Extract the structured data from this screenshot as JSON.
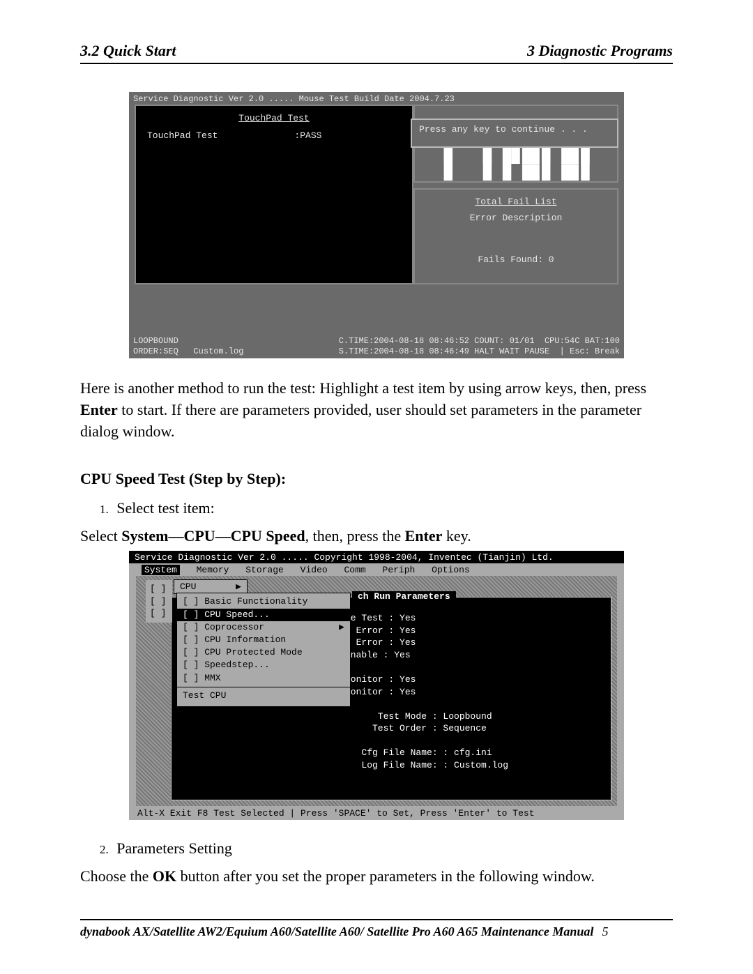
{
  "header": {
    "left": "3.2 Quick Start",
    "right": "3  Diagnostic Programs"
  },
  "screenshot1": {
    "titlebar": "Service Diagnostic Ver 2.0 ..... Mouse Test Build Date 2004.7.23",
    "left_title": "TouchPad Test",
    "left_item": "TouchPad Test",
    "left_status": ":PASS",
    "popup": "Press any key to continue . . .",
    "fail_title": "Total Fail List",
    "fail_headers": "Error  Description",
    "fail_count": "Fails Found: 0",
    "footer_l1_left": "LOOPBOUND",
    "footer_l1_right": "C.TIME:2004-08-18 08:46:52 COUNT: 01/01  CPU:54C BAT:100",
    "footer_l2_left": "ORDER:SEQ   Custom.log",
    "footer_l2_right": "S.TIME:2004-08-18 08:46:49 HALT WAIT PAUSE  | Esc: Break"
  },
  "para1_a": "Here is another method to run the test: Highlight a test item by using arrow keys, then, press ",
  "para1_b": "Enter",
  "para1_c": " to start. If there are parameters provided, user should set parameters in the parameter dialog window.",
  "section_head": "CPU Speed Test (Step by Step):",
  "step1_num": "1.",
  "step1_text": "Select test item:",
  "select_a": "Select ",
  "select_b": "System—CPU—CPU Speed",
  "select_c": ", then, press the ",
  "select_d": "Enter",
  "select_e": " key.",
  "screenshot2": {
    "titlebar": "Service Diagnostic Ver 2.0 ..... Copyright 1998-2004, Inventec (Tianjin) Ltd.",
    "menu": [
      "System",
      "Memory",
      "Storage",
      "Video",
      "Comm",
      "Periph",
      "Options"
    ],
    "side_items": "[ ]\n[ ]\n[ ]",
    "cpu_label": "CPU",
    "submenu": [
      "[ ] Basic Functionality",
      "[ ] CPU Speed...",
      "[ ] Coprocessor",
      "[ ] CPU Information",
      "[ ] CPU Protected Mode",
      "[ ] Speedstep...",
      "[ ] MMX"
    ],
    "submenu_caption": "Test CPU",
    "main_title": "ch Run Parameters",
    "params": "ve Test : Yes\nn Error : Yes\nn Error : Yes\nEnable : Yes\n\nMonitor : Yes\nMonitor : Yes\n\n      Test Mode : Loopbound\n     Test Order : Sequence\n\n   Cfg File Name: : cfg.ini\n   Log File Name: : Custom.log",
    "footer": "Alt-X Exit  F8 Test Selected |  Press 'SPACE' to Set, Press 'Enter' to Test"
  },
  "step2_num": "2.",
  "step2_text": "Parameters Setting",
  "closing_a": "Choose the ",
  "closing_b": "OK",
  "closing_c": " button after you set the proper parameters in the following window.",
  "footer": {
    "title": "dynabook AX/Satellite AW2/Equium A60/Satellite A60/ Satellite Pro A60 A65  Maintenance Manual",
    "page": "5"
  }
}
